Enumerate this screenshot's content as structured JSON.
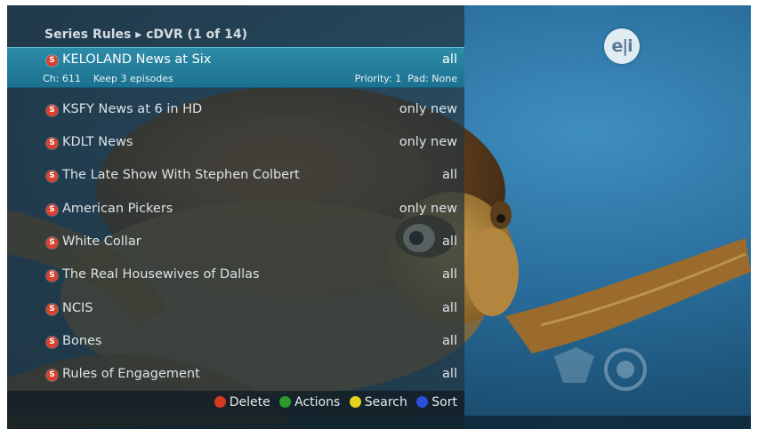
{
  "header": {
    "title": "Series Rules ▸ cDVR (1 of 14)"
  },
  "channel_logo": {
    "text": "e|i"
  },
  "rules": [
    {
      "title": "KELOLAND News at Six",
      "rule": "all",
      "selected": true,
      "details": {
        "channel": "Ch: 611",
        "keep": "Keep 3 episodes",
        "priority": "Priority: 1",
        "pad": "Pad: None"
      }
    },
    {
      "title": "KSFY News at 6 in HD",
      "rule": "only new"
    },
    {
      "title": "KDLT News",
      "rule": "only new"
    },
    {
      "title": "The Late Show With Stephen Colbert",
      "rule": "all"
    },
    {
      "title": "American Pickers",
      "rule": "only new"
    },
    {
      "title": "White Collar",
      "rule": "all"
    },
    {
      "title": "The Real Housewives of Dallas",
      "rule": "all"
    },
    {
      "title": "NCIS",
      "rule": "all"
    },
    {
      "title": "Bones",
      "rule": "all"
    },
    {
      "title": "Rules of Engagement",
      "rule": "all"
    }
  ],
  "record_badge": {
    "letter": "S",
    "color": "#d9412e"
  },
  "legend": [
    {
      "label": "Delete",
      "color": "#d63a22",
      "icon": "red-button-icon"
    },
    {
      "label": "Actions",
      "color": "#2e9a2e",
      "icon": "green-button-icon"
    },
    {
      "label": "Search",
      "color": "#e8d21e",
      "icon": "yellow-button-icon"
    },
    {
      "label": "Sort",
      "color": "#2a4fd8",
      "icon": "blue-button-icon"
    }
  ],
  "colors": {
    "selection": "#1f7e9e",
    "panel": "#24343e"
  }
}
